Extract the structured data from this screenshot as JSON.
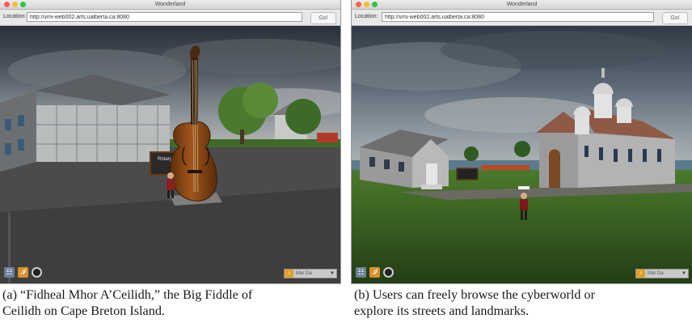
{
  "panel_a": {
    "window_title": "Wonderland",
    "location_label": "Location:",
    "location_url": "http://vmi-web002.arts.ualberta.ca:8080",
    "go_label": "Go!",
    "sign_text": "Rotary",
    "audio_label": "Mar Da"
  },
  "panel_b": {
    "window_title": "Wonderland",
    "location_label": "Location:",
    "location_url": "http://vmi-web002.arts.ualberta.ca:8080",
    "go_label": "Go!",
    "audio_label": "Mar Da"
  },
  "captions": {
    "a_line1": "(a) “Fidheal Mhor A’Ceilidh,” the Big Fiddle of",
    "a_line2": "Ceilidh on Cape Breton Island.",
    "b_line1": "(b) Users can freely browse the cyberworld or",
    "b_line2": "explore its streets and landmarks."
  },
  "icons": {
    "toolbar": [
      "grid-icon",
      "info-icon",
      "camera-icon"
    ],
    "audio": "speaker-icon"
  },
  "colors": {
    "close": "#fc5f57",
    "minimize": "#fdbc2e",
    "zoom": "#28c840",
    "fiddle": "#8b4a16",
    "grass": "#3f6b28"
  }
}
